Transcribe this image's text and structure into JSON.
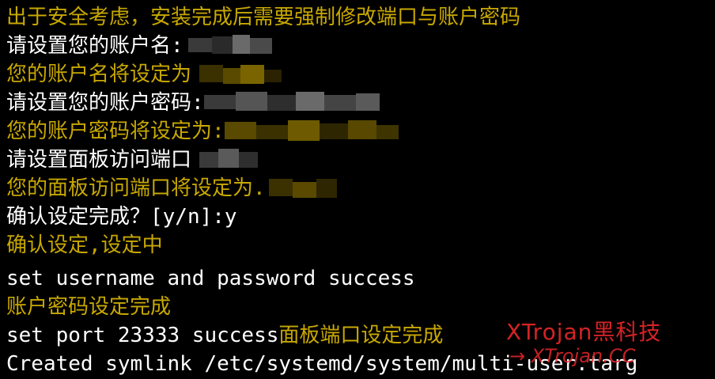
{
  "terminal": {
    "lines": [
      {
        "text": "出于安全考虑，安装完成后需要强制修改端口与账户密码",
        "color": "yellow"
      },
      {
        "text": "请设置您的账户名:",
        "color": "white"
      },
      {
        "text": "您的账户名将设定为",
        "color": "yellow"
      },
      {
        "text": "请设置您的账户密码:",
        "color": "white"
      },
      {
        "text": "您的账户密码将设定为:",
        "color": "yellow"
      },
      {
        "text": "请设置面板访问端口",
        "color": "white"
      },
      {
        "text": "您的面板访问端口将设定为.",
        "color": "yellow"
      },
      {
        "text": "确认设定完成？[y/n]:y",
        "color": "white"
      },
      {
        "text": "确认设定,设定中",
        "color": "yellow"
      },
      {
        "text": "set username and password success",
        "color": "white"
      },
      {
        "text": "账户密码设定完成",
        "color": "yellow"
      },
      {
        "text": "set port 23333 success",
        "color": "white",
        "suffix": "面板端口设定完成"
      },
      {
        "text": "Created symlink /etc/systemd/system/multi-user.targ",
        "color": "white"
      }
    ],
    "colors": {
      "background": "#000000",
      "white": "#ffffff",
      "yellow": "#c8a800"
    }
  },
  "watermark": {
    "title": "XTrojan黑科技",
    "url": "→ XTrojan.CC",
    "color": "#e8262a"
  }
}
